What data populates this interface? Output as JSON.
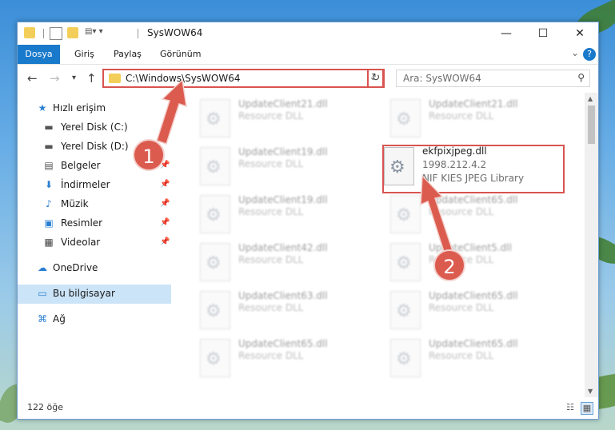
{
  "window": {
    "title": "SysWOW64"
  },
  "titlebar_controls": {
    "minimize": "—",
    "maximize": "☐",
    "close": "✕"
  },
  "ribbon": {
    "tabs": [
      "Dosya",
      "Giriş",
      "Paylaş",
      "Görünüm"
    ],
    "help": "?"
  },
  "navigation": {
    "address": "C:\\Windows\\SysWOW64",
    "search_placeholder": "Ara: SysWOW64"
  },
  "sidebar": {
    "items": [
      {
        "label": "Hızlı erişim",
        "icon": "star-icon"
      },
      {
        "label": "Yerel Disk (C:)",
        "icon": "drive-icon"
      },
      {
        "label": "Yerel Disk (D:)",
        "icon": "drive-icon"
      },
      {
        "label": "Belgeler",
        "icon": "document-icon"
      },
      {
        "label": "İndirmeler",
        "icon": "download-icon"
      },
      {
        "label": "Müzik",
        "icon": "music-icon"
      },
      {
        "label": "Resimler",
        "icon": "pictures-icon"
      },
      {
        "label": "Videolar",
        "icon": "video-icon"
      },
      {
        "label": "OneDrive",
        "icon": "cloud-icon"
      },
      {
        "label": "Bu bilgisayar",
        "icon": "computer-icon"
      },
      {
        "label": "Ağ",
        "icon": "network-icon"
      }
    ]
  },
  "files": [
    {
      "name": "UpdateClient21.dll",
      "type": "Resource DLL"
    },
    {
      "name": "UpdateClient21.dll",
      "type": "Resource DLL"
    },
    {
      "name": "UpdateClient19.dll",
      "type": "Resource DLL"
    },
    {
      "name": "ekfpixjpeg.dll",
      "version": "1998.212.4.2",
      "type": "NIF KIES JPEG Library"
    },
    {
      "name": "UpdateClient19.dll",
      "type": "Resource DLL"
    },
    {
      "name": "UpdateClient65.dll",
      "type": "Resource DLL"
    },
    {
      "name": "UpdateClient42.dll",
      "type": "Resource DLL"
    },
    {
      "name": "UpdateClient5.dll",
      "type": "Resource DLL"
    },
    {
      "name": "UpdateClient63.dll",
      "type": "Resource DLL"
    },
    {
      "name": "UpdateClient65.dll",
      "type": "Resource DLL"
    },
    {
      "name": "UpdateClient65.dll",
      "type": "Resource DLL"
    },
    {
      "name": "UpdateClient65.dll",
      "type": "Resource DLL"
    }
  ],
  "annotations": {
    "step1": "1",
    "step2": "2",
    "color": "#dc5b4f"
  },
  "status": {
    "count": "122 öğe"
  }
}
